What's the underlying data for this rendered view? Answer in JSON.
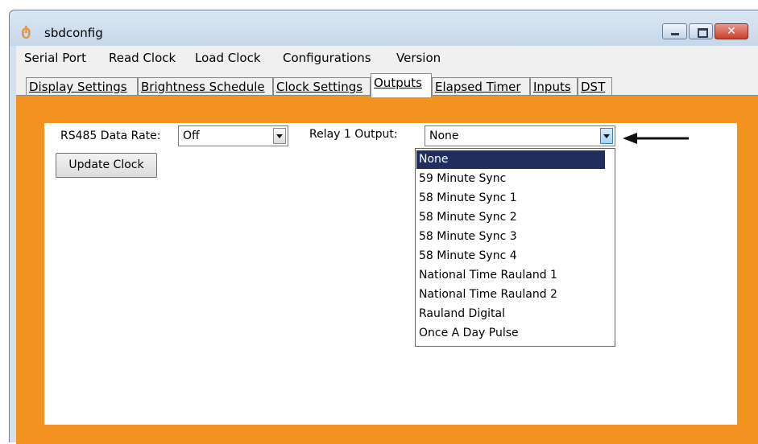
{
  "window": {
    "title": "sbdconfig"
  },
  "menu": [
    "Serial Port",
    "Read Clock",
    "Load Clock",
    "Configurations",
    "Version"
  ],
  "tabs": [
    {
      "label": "Display Settings",
      "active": false
    },
    {
      "label": "Brightness Schedule",
      "active": false
    },
    {
      "label": "Clock Settings",
      "active": false
    },
    {
      "label": "Outputs",
      "active": true
    },
    {
      "label": "Elapsed Timer",
      "active": false
    },
    {
      "label": "Inputs",
      "active": false
    },
    {
      "label": "DST",
      "active": false
    }
  ],
  "outputs": {
    "rs485_label": "RS485 Data Rate:",
    "rs485_value": "Off",
    "relay_label": "Relay 1 Output:",
    "relay_value": "None",
    "update_button": "Update Clock",
    "relay_options": [
      "None",
      "59 Minute Sync",
      "58 Minute Sync 1",
      "58 Minute Sync 2",
      "58 Minute Sync 3",
      "58 Minute Sync 4",
      "National Time Rauland 1",
      "National Time Rauland 2",
      "Rauland Digital",
      "Once A Day Pulse"
    ],
    "selected_option": "None"
  },
  "colors": {
    "panel": "#f2931f",
    "selection": "#1f2e5f",
    "titlebar": "#d3e0ef"
  }
}
